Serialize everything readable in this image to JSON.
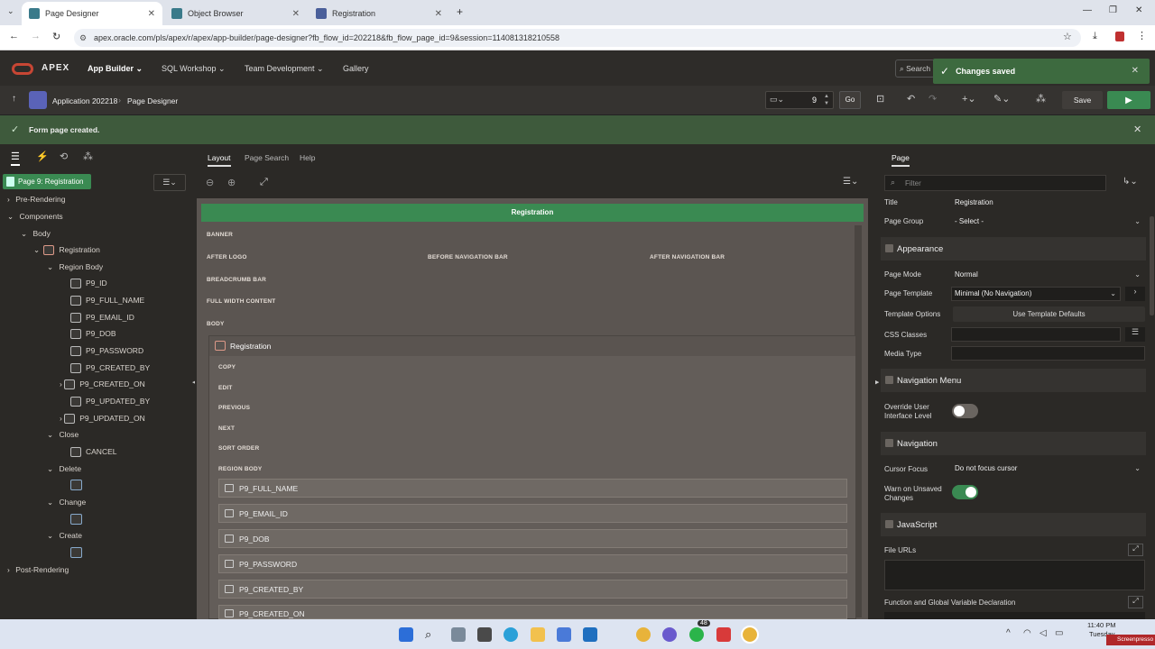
{
  "browser": {
    "tabs": [
      {
        "label": "Page Designer"
      },
      {
        "label": "Object Browser"
      },
      {
        "label": "Registration"
      }
    ],
    "url": "apex.oracle.com/pls/apex/r/apex/app-builder/page-designer?fb_flow_id=202218&fb_flow_page_id=9&session=114081318210558"
  },
  "apex": {
    "brand": "APEX",
    "nav": [
      "App Builder",
      "SQL Workshop",
      "Team Development",
      "Gallery"
    ],
    "search_label": "Search",
    "toast": "Changes saved",
    "breadcrumb": [
      "Application 202218",
      "Page Designer"
    ],
    "page_number": "9",
    "go_label": "Go",
    "save_label": "Save",
    "message": "Form page created."
  },
  "tree": {
    "page_label": "Page 9: Registration",
    "items": [
      "Pre-Rendering",
      "Components",
      "Body",
      "Registration",
      "Region Body",
      "P9_ID",
      "P9_FULL_NAME",
      "P9_EMAIL_ID",
      "P9_DOB",
      "P9_PASSWORD",
      "P9_CREATED_BY",
      "P9_CREATED_ON",
      "P9_UPDATED_BY",
      "P9_UPDATED_ON",
      "Close",
      "CANCEL",
      "Delete",
      "Change",
      "Create",
      "Post-Rendering"
    ]
  },
  "center": {
    "tabs": [
      "Layout",
      "Page Search",
      "Help"
    ],
    "header": "Registration",
    "positions": {
      "banner": "BANNER",
      "after_logo": "AFTER LOGO",
      "before_nav": "BEFORE NAVIGATION BAR",
      "after_nav": "AFTER NAVIGATION BAR",
      "breadcrumb": "BREADCRUMB BAR",
      "full_width": "FULL WIDTH CONTENT",
      "body": "BODY"
    },
    "region_title": "Registration",
    "region_positions": [
      "COPY",
      "EDIT",
      "PREVIOUS",
      "NEXT",
      "SORT ORDER",
      "REGION BODY"
    ],
    "fields": [
      "P9_FULL_NAME",
      "P9_EMAIL_ID",
      "P9_DOB",
      "P9_PASSWORD",
      "P9_CREATED_BY",
      "P9_CREATED_ON"
    ]
  },
  "right": {
    "tab": "Page",
    "filter_placeholder": "Filter",
    "title_label": "Title",
    "title_value": "Registration",
    "group_label": "Page Group",
    "group_value": "- Select -",
    "appearance": "Appearance",
    "mode_label": "Page Mode",
    "mode_value": "Normal",
    "template_label": "Page Template",
    "template_value": "Minimal (No Navigation)",
    "options_label": "Template Options",
    "options_button": "Use Template Defaults",
    "css_label": "CSS Classes",
    "media_label": "Media Type",
    "navmenu": "Navigation Menu",
    "override_label": "Override User Interface Level",
    "navigation": "Navigation",
    "cursor_label": "Cursor Focus",
    "cursor_value": "Do not focus cursor",
    "warn_label": "Warn on Unsaved Changes",
    "javascript": "JavaScript",
    "fileurls_label": "File URLs",
    "funcdecl_label": "Function and Global Variable Declaration"
  },
  "taskbar": {
    "time": "11:40 PM",
    "day": "Tuesday",
    "badge": "48",
    "watermark": "Screenpresso"
  },
  "colors": {
    "accent_green": "#3a8a52",
    "message_bg": "#3e5a3c",
    "apex_red": "#c74634"
  }
}
